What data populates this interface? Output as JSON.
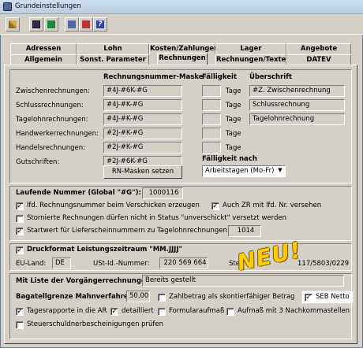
{
  "window": {
    "title": "Grundeinstellungen"
  },
  "toolbar": {
    "icons": [
      "key-icon",
      "save-icon",
      "import-icon",
      "print-icon",
      "preview-icon",
      "help-icon"
    ]
  },
  "tabs": {
    "row1": [
      "Adressen",
      "Lohn",
      "Kosten/Zahlungen",
      "Lager",
      "Angebote"
    ],
    "row2": [
      "Allgemein",
      "Sonst. Parameter",
      "Rechnungen",
      "Rechnungen/Texte",
      "DATEV"
    ],
    "active": "Rechnungen"
  },
  "numbers": {
    "header_mask": "Rechnungsnummer-Maske",
    "header_due": "Fälligkeit",
    "header_title": "Überschrift",
    "tage": "Tage",
    "rows": [
      {
        "label": "Zwischenrechnungen:",
        "mask": "#4J-#6K-#G",
        "days": "",
        "title": "#Z. Zwischenrechnung"
      },
      {
        "label": "Schlussrechnungen:",
        "mask": "#4J-#K-#G",
        "days": "",
        "title": "Schlussrechnung"
      },
      {
        "label": "Tagelohnrechnungen:",
        "mask": "#4J-#K-#G",
        "days": "",
        "title": "Tagelohnrechnung"
      },
      {
        "label": "Handwerkerrechnungen:",
        "mask": "#2J-#K-#G",
        "days": "",
        "title": ""
      },
      {
        "label": "Handelsrechnungen:",
        "mask": "#2J-#K-#G",
        "days": "",
        "title": ""
      },
      {
        "label": "Gutschriften:",
        "mask": "#2J-#6K-#G",
        "days": "",
        "title": ""
      }
    ],
    "reset_button": "RN-Masken setzen",
    "due_after_label": "Fälligkeit nach",
    "due_after_value": "Arbeitstagen (Mo-Fr)"
  },
  "running": {
    "label": "Laufende Nummer (Global \"#G\"):",
    "value": "1000116",
    "cb_lfd": "lfd. Rechnungsnummer beim Verschicken erzeugen",
    "cb_zr": "Auch ZR mit lfd. Nr. versehen",
    "cb_storno": "Stornierte Rechnungen dürfen nicht in Status \"unverschickt\" versetzt werden",
    "cb_start": "Startwert für Lieferscheinnummern zu Tagelohnrechnungen:",
    "start_value": "1014"
  },
  "print": {
    "cb_druckformat": "Druckformat Leistungszeitraum \"MM.JJJJ\"",
    "eu_label": "EU-Land:",
    "eu_value": "DE",
    "ust_label": "USt-Id.-Nummer:",
    "ust_value": "220 569 664",
    "st_label": "Ste",
    "st_value": "117/5803/0229"
  },
  "badge": {
    "text": "NEU!"
  },
  "bottom": {
    "vorgang_label": "Mit Liste der Vorgängerrechnungen:",
    "vorgang_value": "Bereits gestellt",
    "bagatell_label": "Bagatellgrenze Mahnverfahren:",
    "bagatell_value": "50,00",
    "cb_skonto": "Zahlbetrag als skontierfähiger Betrag",
    "cb_seb": "SEB Netto",
    "cb_tagesrapporte": "Tagesrapporte in die AR",
    "cb_detailliert": "detailliert",
    "cb_formular": "Formularaufmaß",
    "cb_aufmass": "Aufmaß mit 3 Nachkommastellen",
    "cb_steuer": "Steuerschuldnerbescheinigungen prüfen"
  },
  "checks": {
    "lfd": true,
    "zr": true,
    "storno": false,
    "start": true,
    "druckformat": true,
    "skonto": false,
    "seb": true,
    "tagesrapporte": true,
    "detailliert": true,
    "formular": false,
    "aufmass": false,
    "steuer": false
  }
}
